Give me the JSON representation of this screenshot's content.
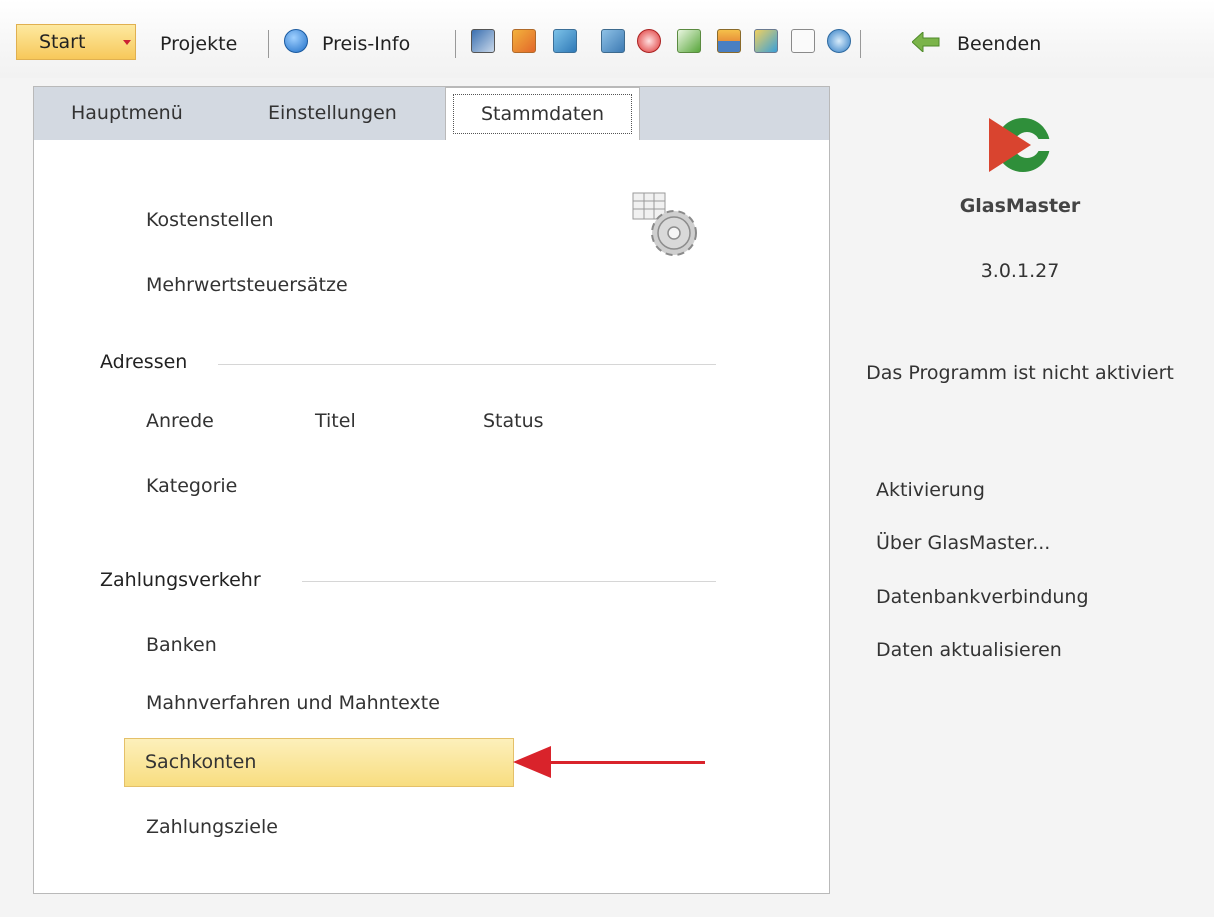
{
  "toolbar": {
    "start_label": "Start",
    "projekte_label": "Projekte",
    "preis_info_label": "Preis-Info",
    "beenden_label": "Beenden",
    "icons": [
      "info-icon",
      "customers-icon",
      "glass-icon",
      "mail-icon",
      "document-icon",
      "clock-icon",
      "chart-icon",
      "cards-icon",
      "report-icon",
      "envelope-icon",
      "refresh-icon",
      "back-arrow-icon"
    ]
  },
  "tabs": {
    "hauptmenue": "Hauptmenü",
    "einstellungen": "Einstellungen",
    "stammdaten": "Stammdaten"
  },
  "main": {
    "kostenstellen": "Kostenstellen",
    "mehrwertsteuersaetze": "Mehrwertsteuersätze",
    "adressen": {
      "heading": "Adressen",
      "anrede": "Anrede",
      "titel": "Titel",
      "status": "Status",
      "kategorie": "Kategorie"
    },
    "zahlungsverkehr": {
      "heading": "Zahlungsverkehr",
      "banken": "Banken",
      "mahnverfahren": "Mahnverfahren und Mahntexte",
      "sachkonten": "Sachkonten",
      "zahlungsziele": "Zahlungsziele"
    }
  },
  "sidebar": {
    "app_name": "GlasMaster",
    "version": "3.0.1.27",
    "activation_status": "Das Programm ist nicht aktiviert",
    "links": {
      "aktivierung": "Aktivierung",
      "ueber": "Über GlasMaster...",
      "datenbank": "Datenbankverbindung",
      "aktualisieren": "Daten aktualisieren"
    }
  },
  "colors": {
    "highlight": "#f8dd80",
    "arrow": "#d9232b",
    "tabstrip": "#d3d9e1",
    "start_button": "#f7c85a"
  }
}
